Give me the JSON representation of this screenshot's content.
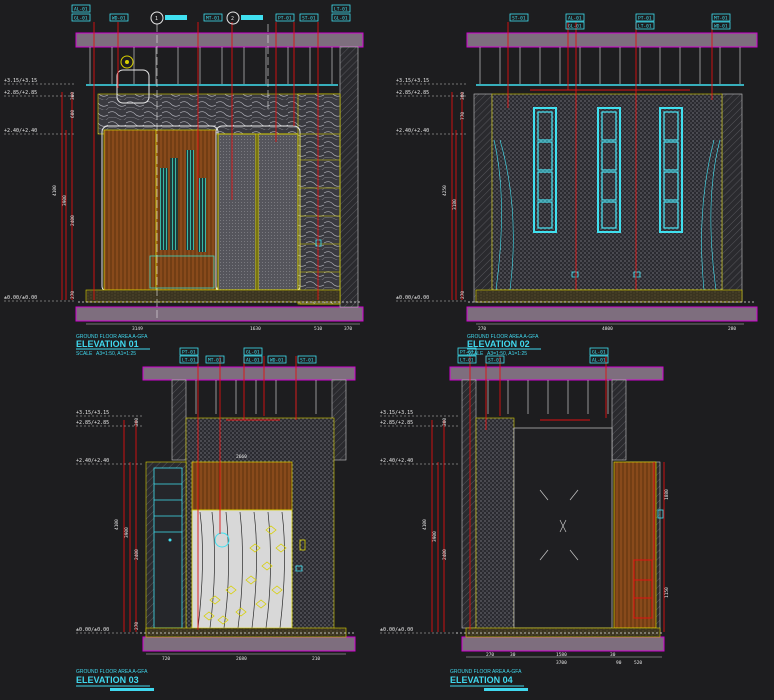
{
  "panels": [
    {
      "key": "e1",
      "title": "ELEVATION 01",
      "subtitle": "GROUND FLOOR AREA A-GFA",
      "scale_label": "SCALE",
      "scale_value": "A3=1:50, A1=1:25",
      "dims_bottom": [
        "3149",
        "1630",
        "510",
        "370"
      ],
      "dims_left": [
        "300",
        "600",
        "4100",
        "3900",
        "2400",
        "270"
      ]
    },
    {
      "key": "e2",
      "title": "ELEVATION 02",
      "subtitle": "GROUND FLOOR AREA A-GFA",
      "scale_label": "SCALE",
      "scale_value": "A3=1:50, A1=1:25",
      "dims_bottom": [
        "270",
        "4800",
        "280"
      ],
      "dims_left": [
        "300",
        "770",
        "4250",
        "3180",
        "270"
      ]
    },
    {
      "key": "e3",
      "title": "ELEVATION 03",
      "subtitle": "GROUND FLOOR AREA A-GFA",
      "dims_bottom": [
        "720",
        "2680",
        "210"
      ],
      "dims_left": [
        "300",
        "4100",
        "3900",
        "2400",
        "270"
      ],
      "dim_inner": "2660"
    },
    {
      "key": "e4",
      "title": "ELEVATION 04",
      "subtitle": "GROUND FLOOR AREA A-GFA",
      "dims_bottom": [
        "270",
        "30",
        "1580",
        "30",
        "90",
        "520"
      ],
      "dims_left": [
        "300",
        "4100",
        "3900",
        "2400"
      ],
      "dim_inner": [
        "3700",
        "1880",
        "1150"
      ]
    }
  ],
  "level_marks": [
    "+3.15/+3.15",
    "+2.85/+2.85",
    "+2.40/+2.40",
    "±0.00/±0.00"
  ],
  "tags": [
    "AL-01",
    "GL-01",
    "WD-01",
    "MT-01",
    "PT-01",
    "ST-01",
    "LT-01"
  ],
  "section_markers": [
    "1",
    "2"
  ],
  "colors": {
    "background": "#1d1d1f",
    "cyan": "#40e0f0",
    "magenta": "#d000d0",
    "slab_fill": "#7e6e7e",
    "red": "#e01010",
    "yellow": "#d8d000",
    "wood": "#8a4a1a"
  }
}
